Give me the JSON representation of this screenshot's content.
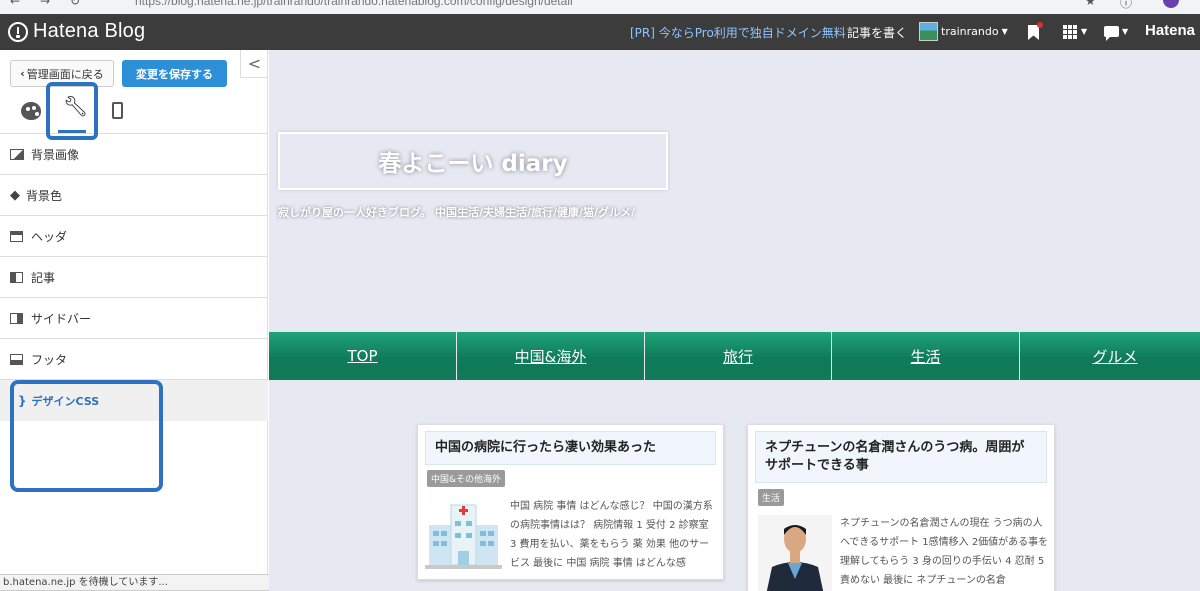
{
  "browser": {
    "url": "https://blog.hatena.ne.jp/trainrando/trainrando.hatenablog.com/config/design/detail",
    "star": "★",
    "info": "ⓘ"
  },
  "topbar": {
    "logo_text": "Hatena Blog",
    "pr_link": "[PR] 今ならPro利用で独自ドメイン無料",
    "write_link": "記事を書く",
    "username": "trainrando",
    "hatena_right": "Hatena"
  },
  "panel": {
    "back_label": "管理画面に戻る",
    "save_label": "変更を保存する",
    "collapse_glyph": "<",
    "menu": [
      {
        "label": "背景画像",
        "icon": "image-icon"
      },
      {
        "label": "背景色",
        "icon": "paint-bucket-icon"
      },
      {
        "label": "ヘッダ",
        "icon": "layout-header-icon"
      },
      {
        "label": "記事",
        "icon": "layout-article-icon"
      },
      {
        "label": "サイドバー",
        "icon": "layout-sidebar-icon"
      },
      {
        "label": "フッタ",
        "icon": "layout-footer-icon"
      }
    ],
    "css_item": {
      "bracket": "}",
      "label": "デザインCSS"
    },
    "highlight_color": "#2d72c2"
  },
  "status_bar": "b.hatena.ne.jp を待機しています...",
  "preview": {
    "blog_title": "春よこーい diary",
    "tagline": "寂しがり屋の一人好きブログ。 中国生活/夫婦生活/旅行/健康/猫/グルメ/",
    "nav": [
      "TOP",
      "中国&海外",
      "旅行",
      "生活",
      "グルメ"
    ],
    "nav_color": "#1a9470",
    "cards": [
      {
        "title": "中国の病院に行ったら凄い効果あった",
        "category": "中国&その他海外",
        "excerpt": "中国 病院 事情 はどんな感じ？ 中国の漢方系の病院事情はは？ 病院情報 1 受付 2 診察室 3 費用を払い、薬をもらう 薬 効果 他のサービス 最後に 中国 病院 事情 はどんな感"
      },
      {
        "title": "ネプチューンの名倉潤さんのうつ病。周囲がサポートできる事",
        "category": "生活",
        "excerpt": "ネプチューンの名倉潤さんの現在 うつ病の人へできるサポート 1感情移入 2価値がある事を理解してもらう 3 身の回りの手伝い 4 忍耐 5責めない 最後に ネプチューンの名倉"
      }
    ]
  }
}
